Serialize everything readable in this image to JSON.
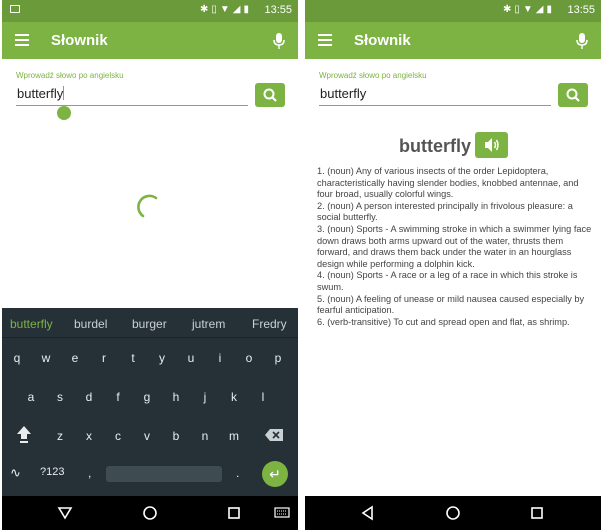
{
  "status": {
    "time": "13:55"
  },
  "app": {
    "title": "Słownik"
  },
  "search": {
    "label": "Wprowadź słowo po angielsku",
    "value": "butterfly"
  },
  "keyboard": {
    "suggestions": [
      "butterfly",
      "burdel",
      "burger",
      "jutrem",
      "Fredry"
    ],
    "row1": [
      "q",
      "w",
      "e",
      "r",
      "t",
      "y",
      "u",
      "i",
      "o",
      "p"
    ],
    "row2": [
      "a",
      "s",
      "d",
      "f",
      "g",
      "h",
      "j",
      "k",
      "l"
    ],
    "row3": [
      "z",
      "x",
      "c",
      "v",
      "b",
      "n",
      "m"
    ],
    "symbols_label": "?123",
    "comma": ",",
    "period": "."
  },
  "result": {
    "word": "butterfly",
    "definitions": [
      "1. (noun) Any of various insects of the order Lepidoptera, characteristically having slender bodies, knobbed antennae, and four broad, usually colorful wings.",
      "2. (noun) A person interested principally in frivolous pleasure: a social butterfly.",
      "3. (noun) Sports - A swimming stroke in which a swimmer lying face down draws both arms upward out of the water, thrusts them forward, and draws them back under the water in an hourglass design while performing a dolphin kick.",
      "4. (noun) Sports - A race or a leg of a race in which this stroke is swum.",
      "5. (noun) A feeling of unease or mild nausea caused especially by fearful anticipation.",
      "6. (verb-transitive) To cut and spread open and flat, as shrimp."
    ]
  },
  "colors": {
    "accent": "#7cb342",
    "status_bar": "#6a9a3a",
    "keyboard_bg": "#253136"
  }
}
